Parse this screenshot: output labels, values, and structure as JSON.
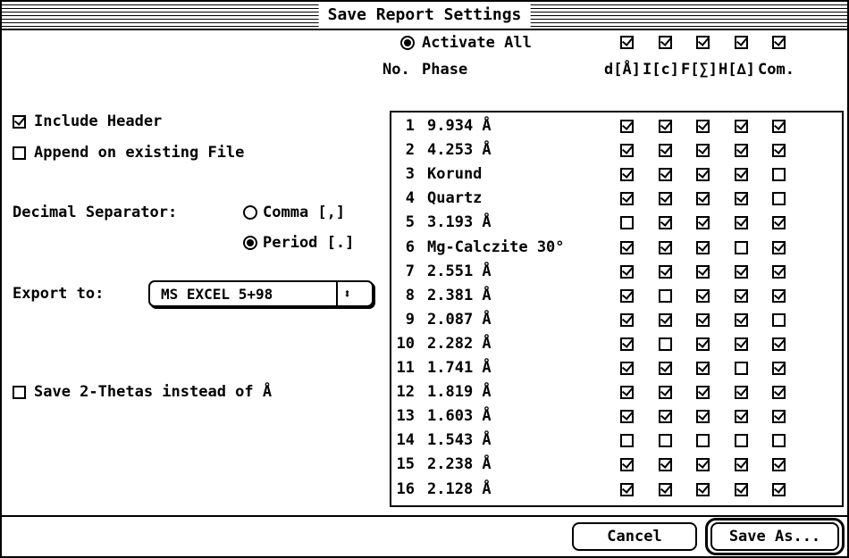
{
  "window": {
    "title": "Save Report Settings"
  },
  "header": {
    "activate_all_label": "Activate All",
    "activate_all_selected": true,
    "activate_all_checks": [
      true,
      true,
      true,
      true,
      true
    ],
    "col_no": "No.",
    "col_phase": "Phase",
    "columns": [
      "d[Å]",
      "I[c]",
      "F[∑]",
      "H[∆]",
      "Com."
    ]
  },
  "options": {
    "include_header_label": "Include Header",
    "include_header_checked": true,
    "append_label": "Append on existing File",
    "append_checked": false,
    "decimal_label": "Decimal Separator:",
    "comma_label": "Comma [,]",
    "comma_selected": false,
    "period_label": "Period [.]",
    "period_selected": true,
    "export_label": "Export to:",
    "export_value": "MS EXCEL 5+98",
    "export_arrows": "⬍",
    "two_theta_label": "Save 2-Thetas instead of Å",
    "two_theta_checked": false
  },
  "rows": [
    {
      "no": "1",
      "phase": "9.934 Å",
      "checks": [
        true,
        true,
        true,
        true,
        true
      ]
    },
    {
      "no": "2",
      "phase": "4.253 Å",
      "checks": [
        true,
        true,
        true,
        true,
        true
      ]
    },
    {
      "no": "3",
      "phase": "Korund",
      "checks": [
        true,
        true,
        true,
        true,
        false
      ]
    },
    {
      "no": "4",
      "phase": "Quartz",
      "checks": [
        true,
        true,
        true,
        true,
        false
      ]
    },
    {
      "no": "5",
      "phase": "3.193 Å",
      "checks": [
        false,
        true,
        true,
        true,
        true
      ]
    },
    {
      "no": "6",
      "phase": "Mg-Calczite 30°",
      "checks": [
        true,
        true,
        true,
        false,
        true
      ]
    },
    {
      "no": "7",
      "phase": "2.551 Å",
      "checks": [
        true,
        true,
        true,
        true,
        true
      ]
    },
    {
      "no": "8",
      "phase": "2.381 Å",
      "checks": [
        true,
        false,
        true,
        true,
        true
      ]
    },
    {
      "no": "9",
      "phase": "2.087 Å",
      "checks": [
        true,
        true,
        true,
        true,
        false
      ]
    },
    {
      "no": "10",
      "phase": "2.282 Å",
      "checks": [
        true,
        false,
        true,
        true,
        true
      ]
    },
    {
      "no": "11",
      "phase": "1.741 Å",
      "checks": [
        true,
        true,
        true,
        false,
        true
      ]
    },
    {
      "no": "12",
      "phase": "1.819 Å",
      "checks": [
        true,
        true,
        true,
        true,
        true
      ]
    },
    {
      "no": "13",
      "phase": "1.603 Å",
      "checks": [
        true,
        true,
        true,
        true,
        true
      ]
    },
    {
      "no": "14",
      "phase": "1.543 Å",
      "checks": [
        false,
        false,
        false,
        false,
        false
      ]
    },
    {
      "no": "15",
      "phase": "2.238 Å",
      "checks": [
        true,
        true,
        true,
        true,
        true
      ]
    },
    {
      "no": "16",
      "phase": "2.128 Å",
      "checks": [
        true,
        true,
        true,
        true,
        true
      ]
    }
  ],
  "buttons": {
    "cancel": "Cancel",
    "save_as": "Save As..."
  }
}
